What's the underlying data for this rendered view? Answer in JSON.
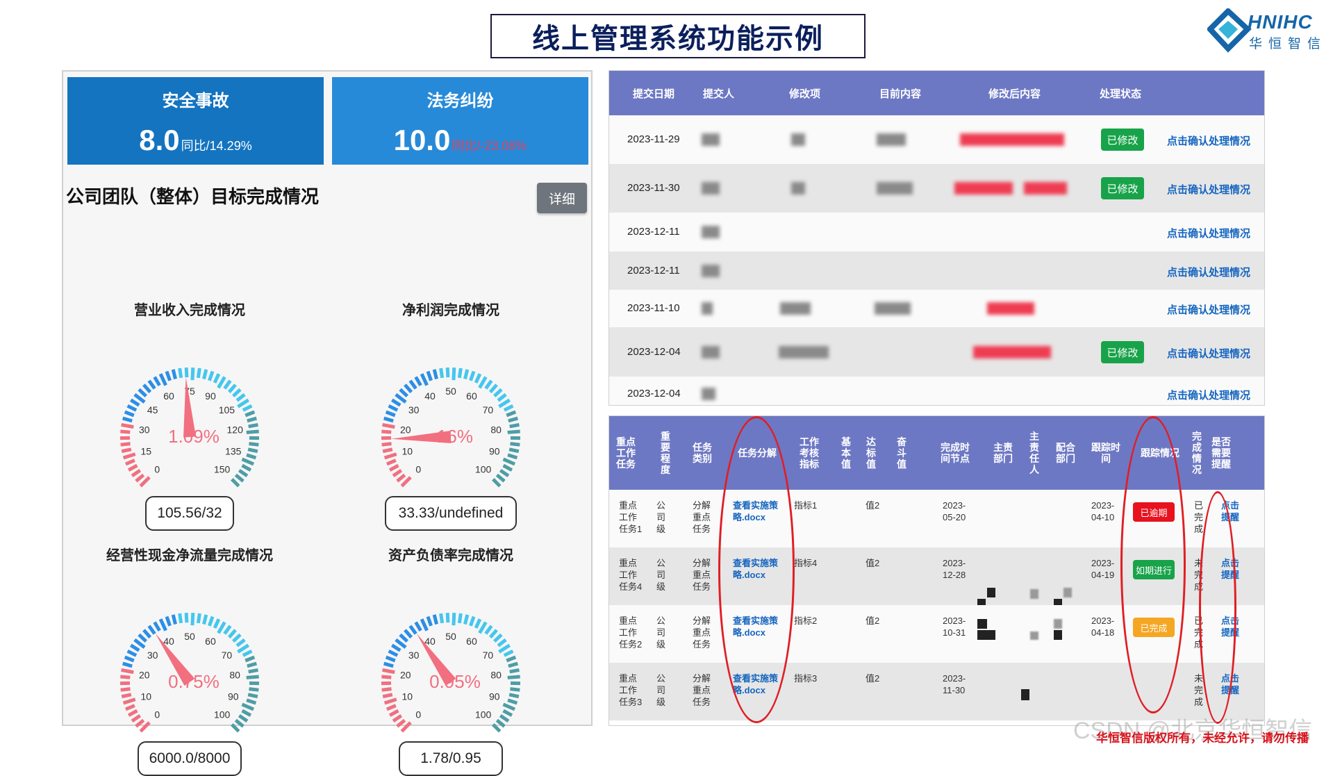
{
  "page_title": "线上管理系统功能示例",
  "logo": {
    "en": "HNIHC",
    "cn": "华恒智信"
  },
  "kpis": [
    {
      "title": "安全事故",
      "value": "8.0",
      "delta": "同比/14.29%"
    },
    {
      "title": "法务纠纷",
      "value": "10.0",
      "delta": "同比/-23.08%"
    }
  ],
  "section_title": "公司团队（整体）目标完成情况",
  "detail_button": "详细",
  "gauges": [
    {
      "title": "营业收入完成情况",
      "percent_label": "1.09%",
      "value_text": "105.56/32",
      "ticks": [
        "0",
        "15",
        "30",
        "45",
        "60",
        "75",
        "90",
        "105",
        "120",
        "135",
        "150"
      ],
      "pointer_value": 73,
      "max": 150
    },
    {
      "title": "净利润完成情况",
      "percent_label": "16%",
      "value_text": "33.33/undefined",
      "ticks": [
        "0",
        "10",
        "20",
        "30",
        "40",
        "50",
        "60",
        "70",
        "80",
        "90",
        "100"
      ],
      "pointer_value": 16,
      "max": 100
    },
    {
      "title": "经营性现金净流量完成情况",
      "percent_label": "0.75%",
      "value_text": "6000.0/8000",
      "ticks": [
        "0",
        "10",
        "20",
        "30",
        "40",
        "50",
        "60",
        "70",
        "80",
        "90",
        "100"
      ],
      "pointer_value": 37,
      "max": 100
    },
    {
      "title": "资产负债率完成情况",
      "percent_label": "0.95%",
      "value_text": "1.78/0.95",
      "ticks": [
        "0",
        "10",
        "20",
        "30",
        "40",
        "50",
        "60",
        "70",
        "80",
        "90",
        "100"
      ],
      "pointer_value": 37,
      "max": 100
    }
  ],
  "table1": {
    "headers": [
      "提交日期",
      "提交人",
      "修改项",
      "目前内容",
      "修改后内容",
      "处理状态"
    ],
    "rows": [
      {
        "date": "2023-11-29",
        "status": "已修改",
        "link": "点击确认处理情况"
      },
      {
        "date": "2023-11-30",
        "status": "已修改",
        "link": "点击确认处理情况"
      },
      {
        "date": "2023-12-11",
        "status": "",
        "link": "点击确认处理情况"
      },
      {
        "date": "2023-12-11",
        "status": "",
        "link": "点击确认处理情况"
      },
      {
        "date": "2023-11-10",
        "status": "",
        "link": "点击确认处理情况"
      },
      {
        "date": "2023-12-04",
        "status": "已修改",
        "link": "点击确认处理情况"
      },
      {
        "date": "2023-12-04",
        "status": "",
        "link": "点击确认处理情况"
      }
    ]
  },
  "table2": {
    "headers": [
      "重点\n工作\n任务",
      "重\n要\n程\n度",
      "任务\n类别",
      "任务分解",
      "工作\n考核\n指标",
      "基\n本\n值",
      "达\n标\n值",
      "奋\n斗\n值",
      "完成时\n间节点",
      "主责\n部门",
      "主\n责\n任\n人",
      "配合\n部门",
      "跟踪时\n间",
      "跟踪情况",
      "完\n成\n情\n况",
      "是否\n需要\n提醒"
    ],
    "rows": [
      {
        "task": "重点\n工作\n任务1",
        "level": "公\n司\n级",
        "category": "分解\n重点\n任务",
        "file": "查看实施策\n略.docx",
        "indicator": "指标1",
        "target": "值2",
        "deadline": "2023-\n05-20",
        "track_time": "2023-\n04-10",
        "status": "已逾期",
        "status_color": "red",
        "done": "已\n完\n成",
        "remind": "点击\n提醒"
      },
      {
        "task": "重点\n工作\n任务4",
        "level": "公\n司\n级",
        "category": "分解\n重点\n任务",
        "file": "查看实施策\n略.docx",
        "indicator": "指标4",
        "target": "值2",
        "deadline": "2023-\n12-28",
        "track_time": "2023-\n04-19",
        "status": "如期进行",
        "status_color": "green",
        "done": "未\n完\n成",
        "remind": "点击\n提醒"
      },
      {
        "task": "重点\n工作\n任务2",
        "level": "公\n司\n级",
        "category": "分解\n重点\n任务",
        "file": "查看实施策\n略.docx",
        "indicator": "指标2",
        "target": "值2",
        "deadline": "2023-\n10-31",
        "track_time": "2023-\n04-18",
        "status": "已完成",
        "status_color": "orange",
        "done": "已\n完\n成",
        "remind": "点击\n提醒"
      },
      {
        "task": "重点\n工作\n任务3",
        "level": "公\n司\n级",
        "category": "分解\n重点\n任务",
        "file": "查看实施策\n略.docx",
        "indicator": "指标3",
        "target": "值2",
        "deadline": "2023-\n11-30",
        "track_time": "",
        "status": "",
        "status_color": "",
        "done": "未\n完\n成",
        "remind": "点击\n提醒"
      }
    ]
  },
  "footer_note": "华恒智信版权所有，未经允许，请勿传播",
  "watermark": "CSDN @北京华恒智信",
  "colors": {
    "header_blue": "#6d78c4",
    "kpi_dark": "#1474c0",
    "kpi_light": "#278ad8",
    "link": "#1565c0",
    "alert_red": "#e01e24"
  }
}
